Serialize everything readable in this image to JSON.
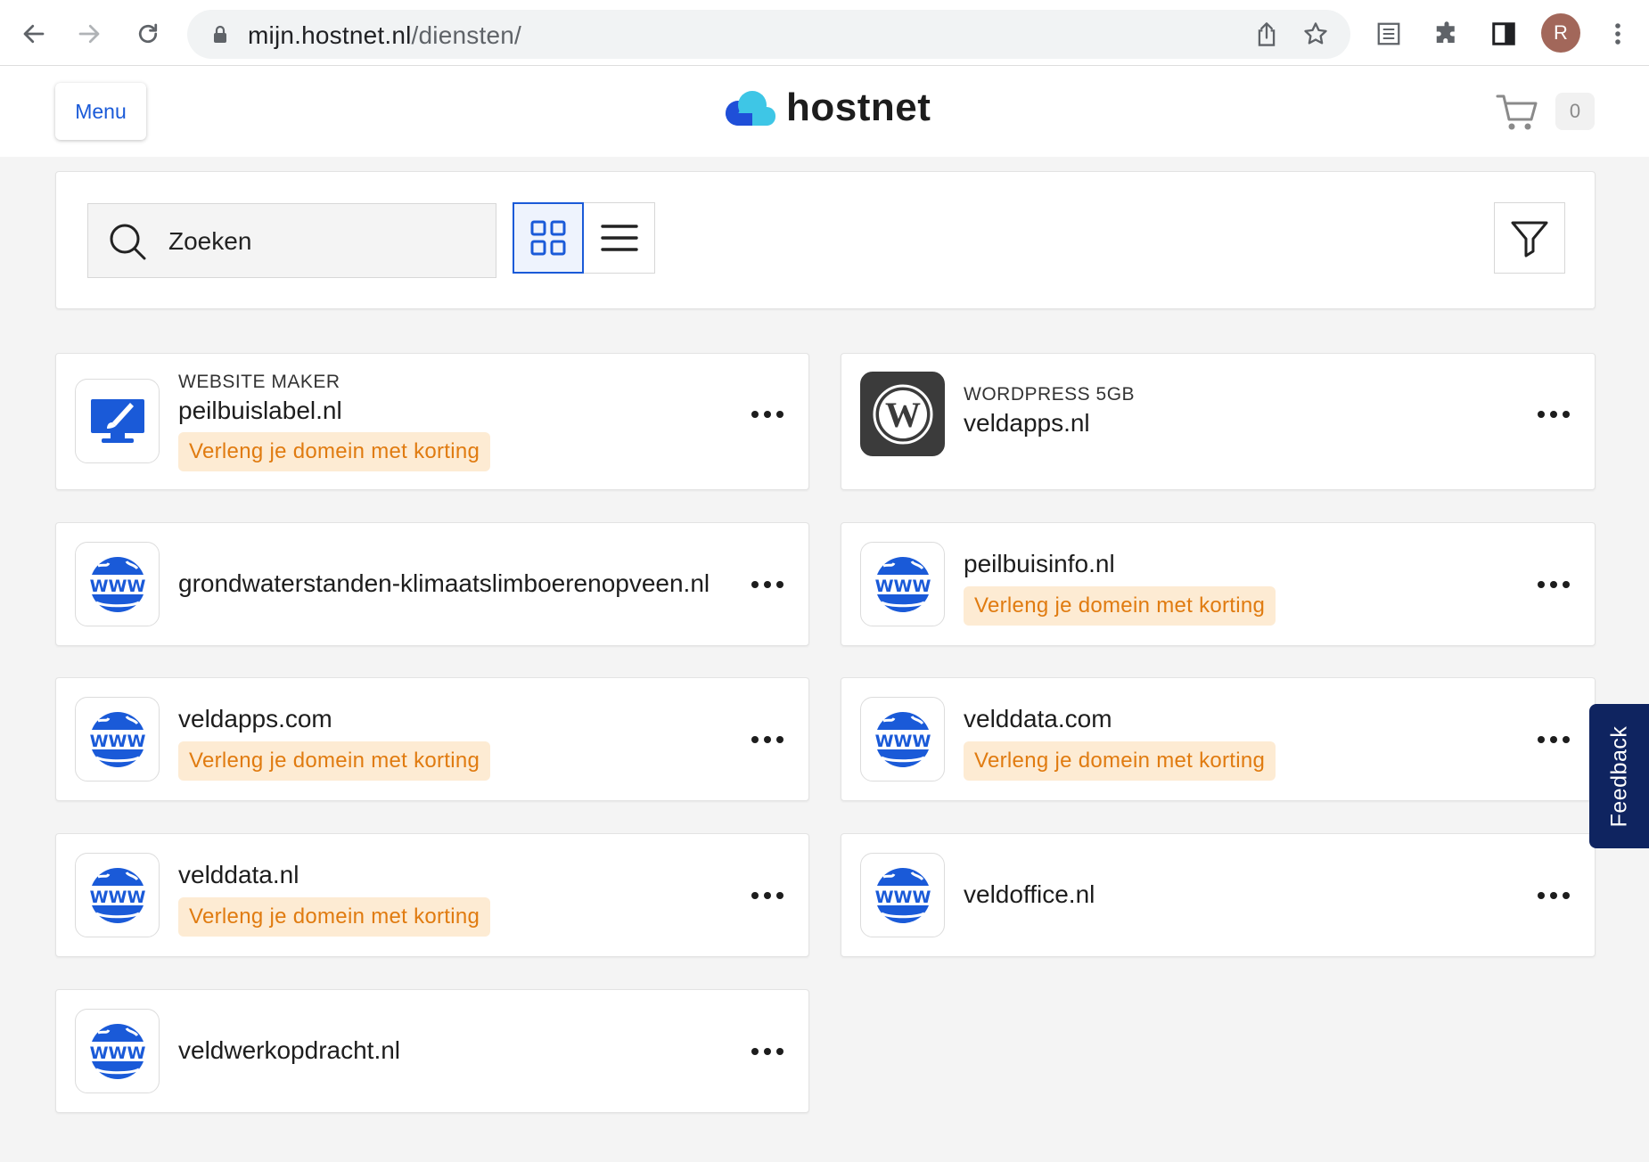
{
  "browser": {
    "url_host": "mijn.hostnet.nl",
    "url_path": "/diensten/",
    "profile_initial": "R"
  },
  "header": {
    "menu_label": "Menu",
    "logo_text": "hostnet",
    "cart_count": "0"
  },
  "toolbar": {
    "search_placeholder": "Zoeken"
  },
  "services": [
    {
      "kind": "WEBSITE MAKER",
      "name": "peilbuislabel.nl",
      "promo": "Verleng je domein met korting",
      "icon": "website-maker-icon"
    },
    {
      "kind": "WORDPRESS 5GB",
      "name": "veldapps.nl",
      "promo": "",
      "icon": "wordpress-icon"
    },
    {
      "kind": "",
      "name": "grondwaterstanden-klimaatslimboerenopveen.nl",
      "promo": "",
      "icon": "www-globe-icon"
    },
    {
      "kind": "",
      "name": "peilbuisinfo.nl",
      "promo": "Verleng je domein met korting",
      "icon": "www-globe-icon"
    },
    {
      "kind": "",
      "name": "veldapps.com",
      "promo": "Verleng je domein met korting",
      "icon": "www-globe-icon"
    },
    {
      "kind": "",
      "name": "velddata.com",
      "promo": "Verleng je domein met korting",
      "icon": "www-globe-icon"
    },
    {
      "kind": "",
      "name": "velddata.nl",
      "promo": "Verleng je domein met korting",
      "icon": "www-globe-icon"
    },
    {
      "kind": "",
      "name": "veldoffice.nl",
      "promo": "",
      "icon": "www-globe-icon"
    },
    {
      "kind": "",
      "name": "veldwerkopdracht.nl",
      "promo": "",
      "icon": "www-globe-icon"
    }
  ],
  "feedback_label": "Feedback",
  "colors": {
    "brand_blue": "#1a5ad8",
    "promo_bg": "#fdebd3",
    "promo_text": "#e07b10",
    "feedback_bg": "#0f2460"
  }
}
